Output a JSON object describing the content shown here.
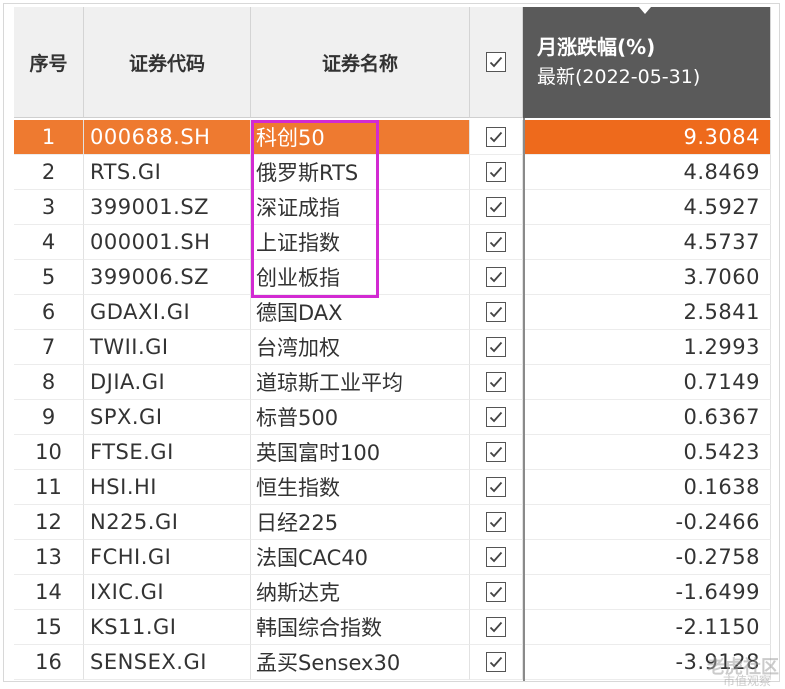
{
  "header": {
    "index": "序号",
    "code": "证券代码",
    "name": "证券名称",
    "change_title": "月涨跌幅(%)",
    "change_sub": "最新(2022-05-31)"
  },
  "colors": {
    "highlight": "#ee7a30",
    "header_dark": "#5a5a5a",
    "selection_box": "#d22ad2"
  },
  "rows": [
    {
      "no": "1",
      "code": "000688.SH",
      "name": "科创50",
      "value": "9.3084",
      "checked": true,
      "highlighted": true
    },
    {
      "no": "2",
      "code": "RTS.GI",
      "name": "俄罗斯RTS",
      "value": "4.8469",
      "checked": true
    },
    {
      "no": "3",
      "code": "399001.SZ",
      "name": "深证成指",
      "value": "4.5927",
      "checked": true
    },
    {
      "no": "4",
      "code": "000001.SH",
      "name": "上证指数",
      "value": "4.5737",
      "checked": true
    },
    {
      "no": "5",
      "code": "399006.SZ",
      "name": "创业板指",
      "value": "3.7060",
      "checked": true
    },
    {
      "no": "6",
      "code": "GDAXI.GI",
      "name": "德国DAX",
      "value": "2.5841",
      "checked": true
    },
    {
      "no": "7",
      "code": "TWII.GI",
      "name": "台湾加权",
      "value": "1.2993",
      "checked": true
    },
    {
      "no": "8",
      "code": "DJIA.GI",
      "name": "道琼斯工业平均",
      "value": "0.7149",
      "checked": true
    },
    {
      "no": "9",
      "code": "SPX.GI",
      "name": "标普500",
      "value": "0.6367",
      "checked": true
    },
    {
      "no": "10",
      "code": "FTSE.GI",
      "name": "英国富时100",
      "value": "0.5423",
      "checked": true
    },
    {
      "no": "11",
      "code": "HSI.HI",
      "name": "恒生指数",
      "value": "0.1638",
      "checked": true
    },
    {
      "no": "12",
      "code": "N225.GI",
      "name": "日经225",
      "value": "-0.2466",
      "checked": true
    },
    {
      "no": "13",
      "code": "FCHI.GI",
      "name": "法国CAC40",
      "value": "-0.2758",
      "checked": true
    },
    {
      "no": "14",
      "code": "IXIC.GI",
      "name": "纳斯达克",
      "value": "-1.6499",
      "checked": true
    },
    {
      "no": "15",
      "code": "KS11.GI",
      "name": "韩国综合指数",
      "value": "-2.1150",
      "checked": true
    },
    {
      "no": "16",
      "code": "SENSEX.GI",
      "name": "孟买Sensex30",
      "value": "-3.9128",
      "checked": true
    }
  ],
  "watermark": {
    "main": "老虎社区",
    "sub": "市值观察"
  }
}
